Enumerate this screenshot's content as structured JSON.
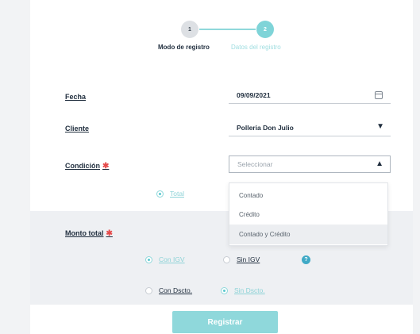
{
  "stepper": {
    "step1": {
      "number": "1",
      "label": "Modo de registro"
    },
    "step2": {
      "number": "2",
      "label": "Datos del registro"
    }
  },
  "form": {
    "fecha": {
      "label": "Fecha",
      "value": "09/09/2021",
      "icon": "calendar-icon"
    },
    "cliente": {
      "label": "Cliente",
      "value": "Polleria Don Julio",
      "icon": "caret-down-icon"
    },
    "condicion": {
      "label": "Condición",
      "required_mark": "✱",
      "placeholder": "Seleccionar",
      "icon": "caret-up-icon"
    },
    "condicion_options": [
      "Contado",
      "Crédito",
      "Contado y Crédito"
    ],
    "pago_tipo": {
      "selected_label": "Total"
    },
    "monto": {
      "label": "Monto total",
      "required_mark": "✱"
    },
    "igv": {
      "con_label": "Con IGV",
      "sin_label": "Sin IGV",
      "help": "?"
    },
    "descuento": {
      "con_label": "Con Dscto.",
      "sin_label": "Sin Dscto."
    },
    "submit_label": "Registrar"
  },
  "colors": {
    "accent": "#8fd8db",
    "required": "#e54b4b",
    "help": "#3fa9c6"
  }
}
